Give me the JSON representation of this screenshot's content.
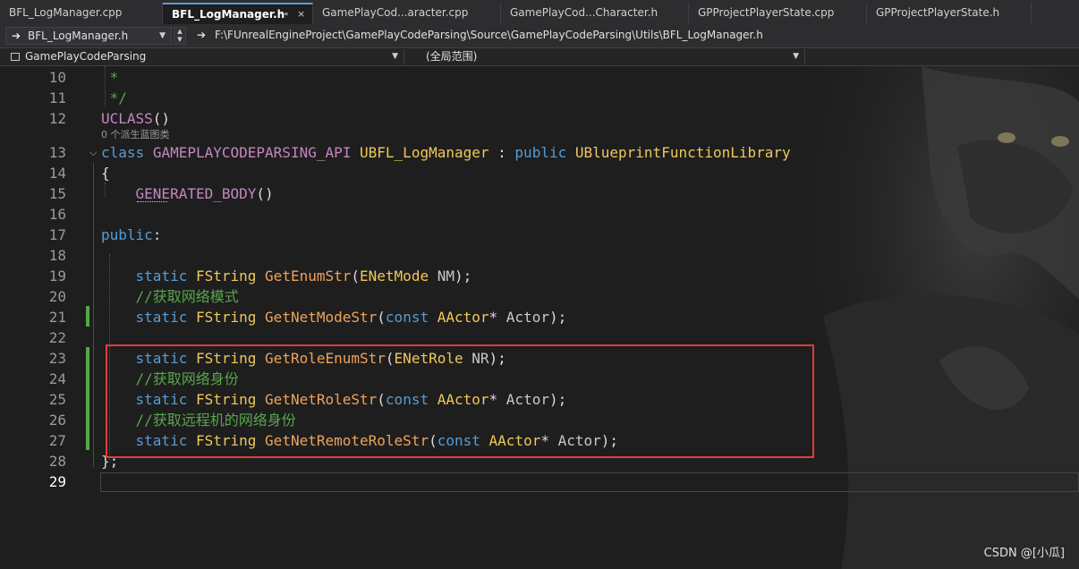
{
  "tabs": [
    {
      "label": "BFL_LogManager.cpp",
      "active": false
    },
    {
      "label": "BFL_LogManager.h",
      "active": true
    },
    {
      "label": "GamePlayCod...aracter.cpp",
      "active": false
    },
    {
      "label": "GamePlayCod...Character.h",
      "active": false
    },
    {
      "label": "GPProjectPlayerState.cpp",
      "active": false
    },
    {
      "label": "GPProjectPlayerState.h",
      "active": false
    }
  ],
  "tab_pin_icon": "⊸",
  "tab_close_icon": "×",
  "nav": {
    "file_combo": "BFL_LogManager.h",
    "path": "F:\\FUnrealEngineProject\\GamePlayCodeParsing\\Source\\GamePlayCodeParsing\\Utils\\BFL_LogManager.h"
  },
  "scope": {
    "project": "GamePlayCodeParsing",
    "global_scope": "(全局范围)"
  },
  "editor": {
    "line_numbers": [
      "10",
      "11",
      "12",
      "13",
      "14",
      "15",
      "16",
      "17",
      "18",
      "19",
      "20",
      "21",
      "22",
      "23",
      "24",
      "25",
      "26",
      "27",
      "28",
      "29"
    ],
    "codelens_hint": "0 个派生蓝图类",
    "comments": {
      "c20": "//获取网络模式",
      "c24": "//获取网络身份",
      "c26": "//获取远程机的网络身份"
    }
  },
  "watermark": "CSDN @[小瓜]",
  "colors": {
    "keyword": "#569cd6",
    "comment": "#57a64a",
    "function": "#f0a25a",
    "macro": "#c586c0",
    "highlight_box": "#e23b3b",
    "change_bar": "#57a64a"
  }
}
